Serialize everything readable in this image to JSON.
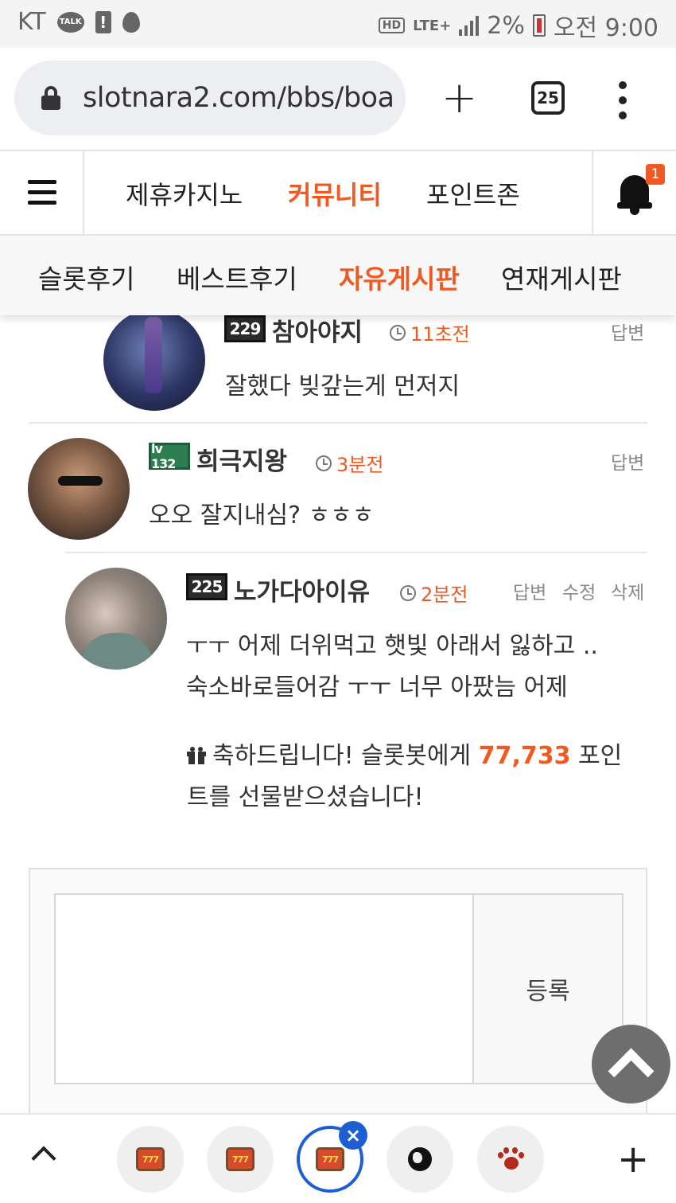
{
  "status_bar": {
    "carrier": "KT",
    "talk_label": "TALK",
    "alert": "!",
    "hd": "HD",
    "lte": "LTE+",
    "battery": "2%",
    "time": "오전 9:00"
  },
  "browser": {
    "url": "slotnara2.com/bbs/boa",
    "new_tab": "+",
    "tab_count": "25"
  },
  "nav": {
    "tabs": [
      "제휴카지노",
      "커뮤니티",
      "포인트존"
    ],
    "active_tab_index": 1,
    "notification_count": "1",
    "subtabs": [
      "슬롯후기",
      "베스트후기",
      "자유게시판",
      "연재게시판"
    ],
    "active_subtab_index": 2
  },
  "comments": [
    {
      "level": "229",
      "username": "참아야지",
      "time": "11초전",
      "actions": [
        "답변"
      ],
      "lines": [
        "잘했다 빚갚는게 먼저지"
      ]
    },
    {
      "level": "lv 132",
      "username": "희극지왕",
      "time": "3분전",
      "actions": [
        "답변"
      ],
      "lines": [
        "오오 잘지내심? ㅎㅎㅎ"
      ]
    },
    {
      "level": "225",
      "username": "노가다아이유",
      "time": "2분전",
      "actions": [
        "답변",
        "수정",
        "삭제"
      ],
      "lines": [
        "ㅜㅜ 어제 더위먹고  햇빛 아래서 잃하고 ..",
        "숙소바로들어감 ㅜㅜ 너무 아팠늠  어제"
      ],
      "gift": {
        "before": "축하드립니다! 슬롯봇에게 ",
        "points": "77,733",
        "after": " 포인트를 선물받으셨습니다!"
      }
    }
  ],
  "form": {
    "textarea_value": "",
    "submit_label": "등록"
  },
  "bottom_bar": {
    "slot_label": "777",
    "close_label": "×",
    "add_label": "+"
  },
  "colors": {
    "accent": "#f05a22",
    "active_tab_ring": "#1d5fd0"
  }
}
